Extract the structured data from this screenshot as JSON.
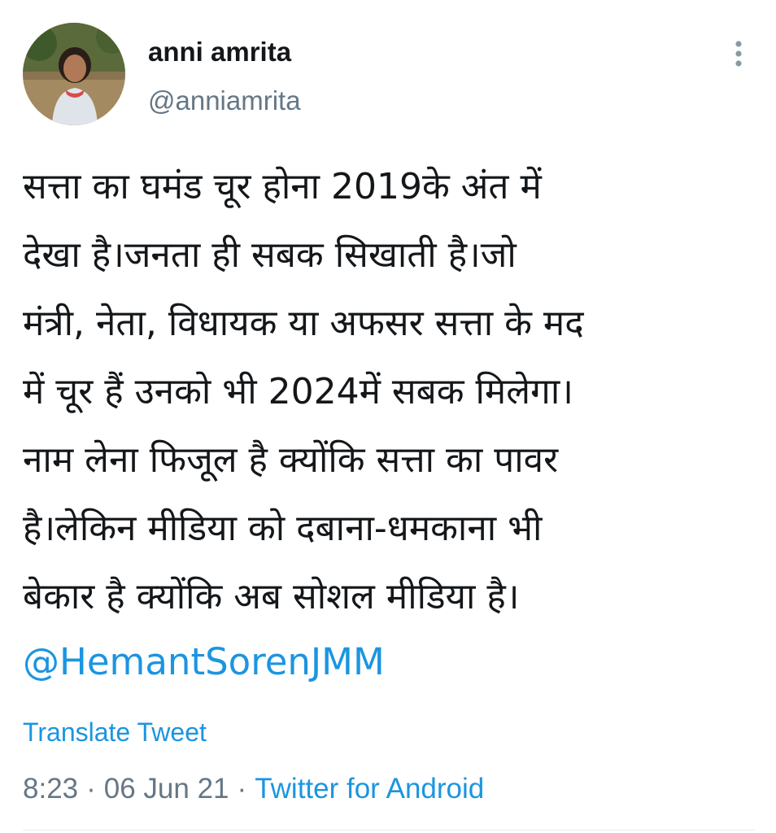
{
  "author": {
    "display_name": "anni amrita",
    "handle": "@anniamrita",
    "avatar_icon": "profile-photo"
  },
  "tweet": {
    "lines": [
      "सत्ता का घमंड चूर होना 2019के अंत में",
      "देखा है।जनता ही सबक सिखाती है।जो",
      "मंत्री, नेता, विधायक या अफसर सत्ता के मद",
      "में चूर हैं उनको भी 2024में सबक मिलेगा।",
      "नाम लेना फिजूल है क्योंकि सत्ता का पावर",
      "है।लेकिन मीडिया को दबाना-धमकाना भी",
      "बेकार है क्योंकि अब सोशल मीडिया है।"
    ],
    "mention": "@HemantSorenJMM",
    "translate_label": "Translate Tweet",
    "time": "8:23",
    "date": "06 Jun 21",
    "separator": "·",
    "source": "Twitter for Android"
  },
  "icons": {
    "more": "more-vertical-icon"
  },
  "colors": {
    "text": "#14171a",
    "secondary": "#657786",
    "link": "#1b95e0",
    "divider": "#e6ecf0"
  }
}
